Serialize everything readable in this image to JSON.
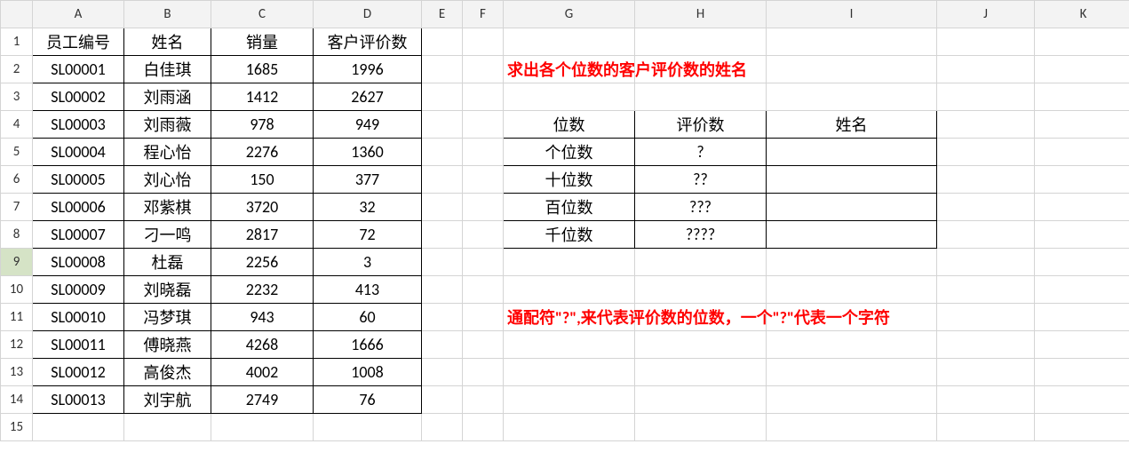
{
  "columns": [
    "A",
    "B",
    "C",
    "D",
    "E",
    "F",
    "G",
    "H",
    "I",
    "J",
    "K"
  ],
  "row_numbers": [
    "1",
    "2",
    "3",
    "4",
    "5",
    "6",
    "7",
    "8",
    "9",
    "10",
    "11",
    "12",
    "13",
    "14",
    "15"
  ],
  "main_table": {
    "headers": {
      "A": "员工编号",
      "B": "姓名",
      "C": "销量",
      "D": "客户评价数"
    },
    "rows": [
      {
        "A": "SL00001",
        "B": "白佳琪",
        "C": "1685",
        "D": "1996"
      },
      {
        "A": "SL00002",
        "B": "刘雨涵",
        "C": "1412",
        "D": "2627"
      },
      {
        "A": "SL00003",
        "B": "刘雨薇",
        "C": "978",
        "D": "949"
      },
      {
        "A": "SL00004",
        "B": "程心怡",
        "C": "2276",
        "D": "1360"
      },
      {
        "A": "SL00005",
        "B": "刘心怡",
        "C": "150",
        "D": "377"
      },
      {
        "A": "SL00006",
        "B": "邓紫棋",
        "C": "3720",
        "D": "32"
      },
      {
        "A": "SL00007",
        "B": "刁一鸣",
        "C": "2817",
        "D": "72"
      },
      {
        "A": "SL00008",
        "B": "杜磊",
        "C": "2256",
        "D": "3"
      },
      {
        "A": "SL00009",
        "B": "刘晓磊",
        "C": "2232",
        "D": "413"
      },
      {
        "A": "SL00010",
        "B": "冯梦琪",
        "C": "943",
        "D": "60"
      },
      {
        "A": "SL00011",
        "B": "傅晓燕",
        "C": "4268",
        "D": "1666"
      },
      {
        "A": "SL00012",
        "B": "高俊杰",
        "C": "4002",
        "D": "1008"
      },
      {
        "A": "SL00013",
        "B": "刘宇航",
        "C": "2749",
        "D": "76"
      }
    ]
  },
  "instruction_1": "求出各个位数的客户评价数的姓名",
  "instruction_2": "通配符\"?\",来代表评价数的位数，一个\"?\"代表一个字符",
  "lookup_table": {
    "headers": {
      "G": "位数",
      "H": "评价数",
      "I": "姓名"
    },
    "rows": [
      {
        "G": "个位数",
        "H": "?",
        "I": ""
      },
      {
        "G": "十位数",
        "H": "??",
        "I": ""
      },
      {
        "G": "百位数",
        "H": "???",
        "I": ""
      },
      {
        "G": "千位数",
        "H": "????",
        "I": ""
      }
    ]
  },
  "selected_row": 9
}
